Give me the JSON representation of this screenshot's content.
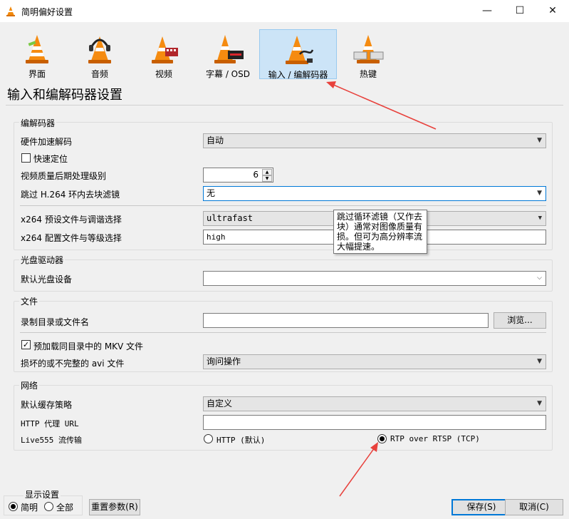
{
  "window": {
    "title": "简明偏好设置",
    "minimize": "—",
    "maximize": "☐",
    "close": "✕"
  },
  "categories": [
    {
      "label": "界面",
      "icon": "vlc-cone-icon"
    },
    {
      "label": "音频",
      "icon": "vlc-cone-headphones-icon"
    },
    {
      "label": "视频",
      "icon": "vlc-cone-film-icon"
    },
    {
      "label": "字幕 / OSD",
      "icon": "vlc-cone-subtitle-icon"
    },
    {
      "label": "输入 / 编解码器",
      "icon": "vlc-cone-cable-icon",
      "selected": true
    },
    {
      "label": "热键",
      "icon": "vlc-cone-keyboard-icon"
    }
  ],
  "page_title": "输入和编解码器设置",
  "codecs": {
    "group_title": "编解码器",
    "hw_decode_label": "硬件加速解码",
    "hw_decode_value": "自动",
    "fast_seek_label": "快速定位",
    "fast_seek_checked": false,
    "post_proc_label": "视频质量后期处理级别",
    "post_proc_value": "6",
    "skip_loop_label": "跳过 H.264 环内去块滤镜",
    "skip_loop_value": "无",
    "x264_preset_label": "x264 预设文件与调谐选择",
    "x264_preset_value": "ultrafast",
    "x264_profile_label": "x264 配置文件与等级选择",
    "x264_profile_value": "high",
    "tooltip": [
      "跳过循环滤镜（又作去",
      "块）通常对图像质量有",
      "损。但可为高分辨率流",
      "大幅提速。"
    ]
  },
  "optical": {
    "group_title": "光盘驱动器",
    "default_device_label": "默认光盘设备",
    "default_device_value": ""
  },
  "files": {
    "group_title": "文件",
    "record_dir_label": "录制目录或文件名",
    "record_dir_value": "",
    "browse_label": "浏览...",
    "mkv_label": "预加载同目录中的 MKV 文件",
    "mkv_checked": true,
    "avi_label": "损坏的或不完整的 avi 文件",
    "avi_value": "询问操作"
  },
  "network": {
    "group_title": "网络",
    "cache_label": "默认缓存策略",
    "cache_value": "自定义",
    "proxy_label": "HTTP 代理 URL",
    "proxy_value": "",
    "live555_label": "Live555 流传输",
    "http_option": "HTTP (默认)",
    "rtp_option": "RTP over RTSP (TCP)",
    "selected": "rtp"
  },
  "display": {
    "group_title": "显示设置",
    "simple_label": "简明",
    "all_label": "全部",
    "selected": "simple"
  },
  "buttons": {
    "reset": "重置参数(R)",
    "save": "保存(S)",
    "cancel": "取消(C)"
  },
  "colors": {
    "arrow": "#e8413c",
    "selection": "#cce4f7",
    "focus": "#0078d7"
  }
}
